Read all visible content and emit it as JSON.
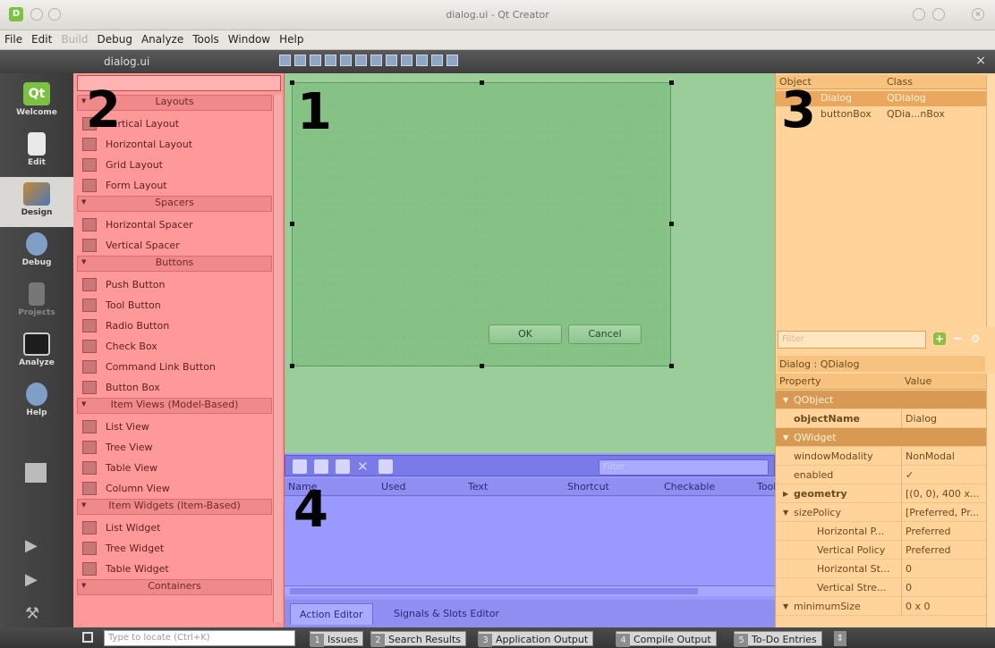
{
  "window": {
    "title": "dialog.ui - Qt Creator"
  },
  "menu": [
    {
      "label": "File",
      "enabled": true
    },
    {
      "label": "Edit",
      "enabled": true
    },
    {
      "label": "Build",
      "enabled": false
    },
    {
      "label": "Debug",
      "enabled": true
    },
    {
      "label": "Analyze",
      "enabled": true
    },
    {
      "label": "Tools",
      "enabled": true
    },
    {
      "label": "Window",
      "enabled": true
    },
    {
      "label": "Help",
      "enabled": true
    }
  ],
  "editor_tab": "dialog.ui",
  "modes": [
    {
      "label": "Welcome",
      "icon": "qt-logo-icon",
      "state": "normal"
    },
    {
      "label": "Edit",
      "icon": "document-icon",
      "state": "normal"
    },
    {
      "label": "Design",
      "icon": "pencil-ruler-icon",
      "state": "active"
    },
    {
      "label": "Debug",
      "icon": "bug-icon",
      "state": "normal"
    },
    {
      "label": "Projects",
      "icon": "projects-icon",
      "state": "dim"
    },
    {
      "label": "Analyze",
      "icon": "monitor-icon",
      "state": "normal"
    },
    {
      "label": "Help",
      "icon": "help-icon",
      "state": "normal"
    }
  ],
  "widget_box": {
    "categories": [
      {
        "title": "Layouts",
        "items": [
          "Vertical Layout",
          "Horizontal Layout",
          "Grid Layout",
          "Form Layout"
        ]
      },
      {
        "title": "Spacers",
        "items": [
          "Horizontal Spacer",
          "Vertical Spacer"
        ]
      },
      {
        "title": "Buttons",
        "items": [
          "Push Button",
          "Tool Button",
          "Radio Button",
          "Check Box",
          "Command Link Button",
          "Button Box"
        ]
      },
      {
        "title": "Item Views (Model-Based)",
        "items": [
          "List View",
          "Tree View",
          "Table View",
          "Column View"
        ]
      },
      {
        "title": "Item Widgets (Item-Based)",
        "items": [
          "List Widget",
          "Tree Widget",
          "Table Widget"
        ]
      },
      {
        "title": "Containers",
        "items": []
      }
    ]
  },
  "region_labels": {
    "one": "1",
    "two": "2",
    "three": "3",
    "four": "4"
  },
  "form": {
    "ok_label": "OK",
    "cancel_label": "Cancel"
  },
  "action_editor": {
    "filter_placeholder": "Filter",
    "columns": [
      "Name",
      "Used",
      "Text",
      "Shortcut",
      "Checkable",
      "ToolTip"
    ],
    "tabs": [
      "Action Editor",
      "Signals & Slots Editor"
    ]
  },
  "object_inspector": {
    "columns": [
      "Object",
      "Class"
    ],
    "rows": [
      {
        "object": "Dialog",
        "class": "QDialog",
        "selected": true
      },
      {
        "object": "buttonBox",
        "class": "QDia...nBox",
        "selected": false
      }
    ]
  },
  "property_editor": {
    "filter_placeholder": "Filter",
    "title": "Dialog : QDialog",
    "columns": [
      "Property",
      "Value"
    ],
    "rows": [
      {
        "name": "QObject",
        "value": "",
        "type": "group"
      },
      {
        "name": "objectName",
        "value": "Dialog",
        "type": "bold"
      },
      {
        "name": "QWidget",
        "value": "",
        "type": "group"
      },
      {
        "name": "windowModality",
        "value": "NonModal",
        "type": "normal"
      },
      {
        "name": "enabled",
        "value": "✓",
        "type": "normal"
      },
      {
        "name": "geometry",
        "value": "[(0, 0), 400 x...",
        "type": "bold-expand"
      },
      {
        "name": "sizePolicy",
        "value": "[Preferred, Pr...",
        "type": "expanded"
      },
      {
        "name": "Horizontal P...",
        "value": "Preferred",
        "type": "child"
      },
      {
        "name": "Vertical Policy",
        "value": "Preferred",
        "type": "child"
      },
      {
        "name": "Horizontal St...",
        "value": "0",
        "type": "child"
      },
      {
        "name": "Vertical Stre...",
        "value": "0",
        "type": "child"
      },
      {
        "name": "minimumSize",
        "value": "0 x 0",
        "type": "expanded"
      }
    ]
  },
  "statusbar": {
    "locator_placeholder": "Type to locate (Ctrl+K)",
    "panes": [
      {
        "num": "1",
        "label": "Issues"
      },
      {
        "num": "2",
        "label": "Search Results"
      },
      {
        "num": "3",
        "label": "Application Output"
      },
      {
        "num": "4",
        "label": "Compile Output"
      },
      {
        "num": "5",
        "label": "To-Do Entries"
      }
    ]
  },
  "colors": {
    "widget_box": "#ff9999",
    "form_editor": "#9acd9a",
    "action_editor": "#9999ff",
    "right_panels": "#ffd39a"
  }
}
